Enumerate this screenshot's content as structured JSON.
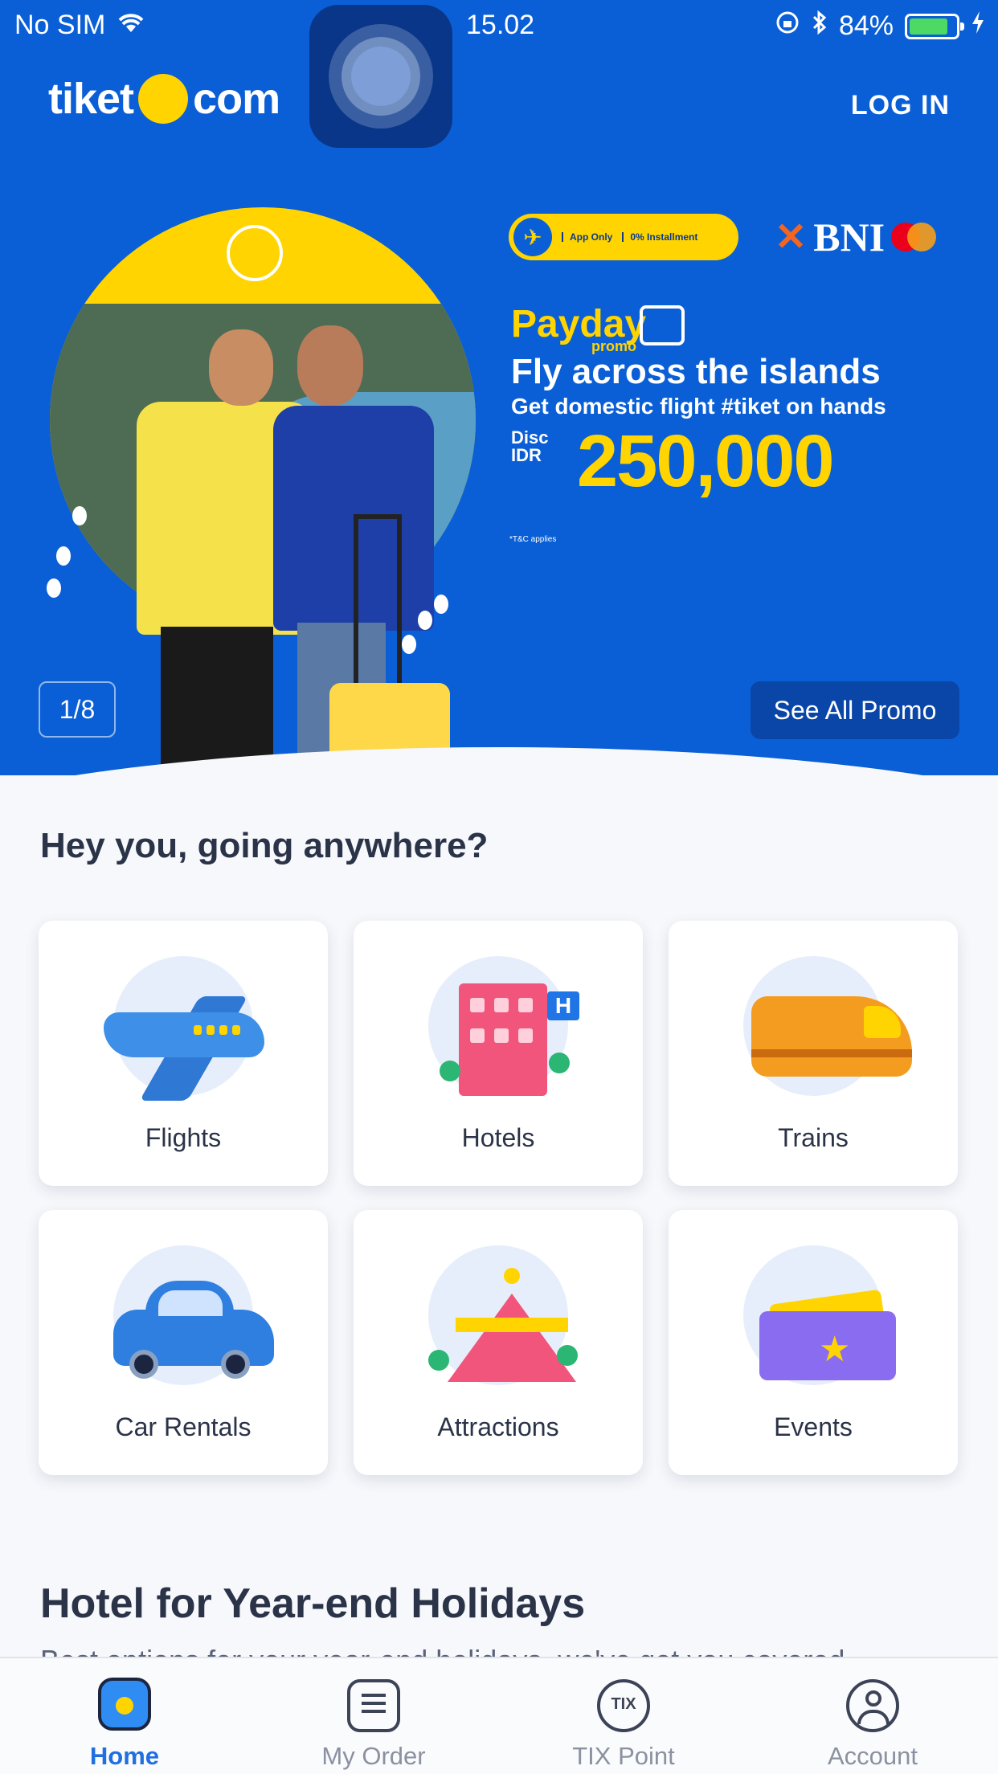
{
  "status_bar": {
    "carrier": "No SIM",
    "time": "15.02",
    "battery_percent": "84%",
    "battery_level": 0.84
  },
  "header": {
    "logo_left": "tiket",
    "logo_right": "com",
    "login_label": "LOG IN"
  },
  "banner": {
    "badge_app_only": "App Only",
    "badge_installment": "0% Installment",
    "bank_name": "BNI",
    "card_brand": "mastercard",
    "promo_word": "Payday",
    "promo_sub": "promo",
    "headline": "Fly across the islands",
    "subline": "Get domestic flight #tiket on hands",
    "disc_label_1": "Disc",
    "disc_label_2": "IDR",
    "amount": "250,000",
    "tnc": "*T&C applies",
    "page_indicator": "1/8",
    "see_all_label": "See All Promo"
  },
  "main": {
    "section_title": "Hey you, going anywhere?",
    "products": [
      {
        "label": "Flights",
        "icon": "airplane-icon"
      },
      {
        "label": "Hotels",
        "icon": "hotel-icon"
      },
      {
        "label": "Trains",
        "icon": "train-icon"
      },
      {
        "label": "Car Rentals",
        "icon": "car-icon"
      },
      {
        "label": "Attractions",
        "icon": "circus-tent-icon"
      },
      {
        "label": "Events",
        "icon": "ticket-icon"
      }
    ],
    "hotel_section_title": "Hotel for Year-end Holidays",
    "hotel_section_subtitle": "Best options for your year-end holidays, we've got you covered."
  },
  "bottom_nav": {
    "items": [
      {
        "label": "Home",
        "icon": "home-icon",
        "active": true
      },
      {
        "label": "My Order",
        "icon": "order-list-icon",
        "active": false
      },
      {
        "label": "TIX Point",
        "icon": "tix-point-icon",
        "active": false
      },
      {
        "label": "Account",
        "icon": "account-icon",
        "active": false
      }
    ]
  },
  "colors": {
    "brand_blue": "#0a5fd6",
    "brand_yellow": "#ffd400",
    "active_tab": "#1f6fe0"
  }
}
